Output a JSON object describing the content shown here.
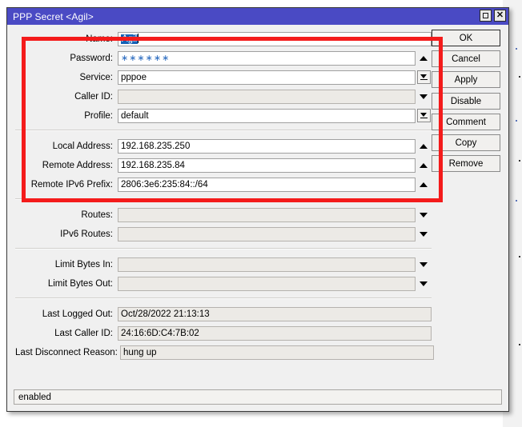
{
  "window": {
    "title": "PPP Secret <Agil>",
    "maximize_icon": "maximize-icon",
    "close_icon": "close-icon",
    "close_glyph": "✕"
  },
  "form": {
    "groups": [
      {
        "name": "credentials",
        "fields": [
          {
            "label": "Name:",
            "value": "Agil",
            "type": "text-selected",
            "adorn": "none",
            "state": "editable"
          },
          {
            "label": "Password:",
            "value": "",
            "type": "password",
            "adorn": "tri-up",
            "state": "editable",
            "masked": "∗∗∗∗∗∗"
          },
          {
            "label": "Service:",
            "value": "pppoe",
            "type": "text",
            "adorn": "dropdown",
            "state": "editable"
          },
          {
            "label": "Caller ID:",
            "value": "",
            "type": "text",
            "adorn": "tri-down",
            "state": "disabled"
          },
          {
            "label": "Profile:",
            "value": "default",
            "type": "text",
            "adorn": "dropdown",
            "state": "editable"
          }
        ]
      },
      {
        "name": "addresses",
        "fields": [
          {
            "label": "Local Address:",
            "value": "192.168.235.250",
            "type": "text",
            "adorn": "tri-up",
            "state": "editable"
          },
          {
            "label": "Remote Address:",
            "value": "192.168.235.84",
            "type": "text",
            "adorn": "tri-up",
            "state": "editable"
          },
          {
            "label": "Remote IPv6 Prefix:",
            "value": "2806:3e6:235:84::/64",
            "type": "text",
            "adorn": "tri-up",
            "state": "editable"
          }
        ]
      },
      {
        "name": "routes",
        "fields": [
          {
            "label": "Routes:",
            "value": "",
            "type": "text",
            "adorn": "tri-down",
            "state": "disabled"
          },
          {
            "label": "IPv6 Routes:",
            "value": "",
            "type": "text",
            "adorn": "tri-down",
            "state": "disabled"
          }
        ]
      },
      {
        "name": "limits",
        "fields": [
          {
            "label": "Limit Bytes In:",
            "value": "",
            "type": "text",
            "adorn": "tri-down",
            "state": "disabled"
          },
          {
            "label": "Limit Bytes Out:",
            "value": "",
            "type": "text",
            "adorn": "tri-down",
            "state": "disabled"
          }
        ]
      },
      {
        "name": "last-session",
        "fields": [
          {
            "label": "Last Logged Out:",
            "value": "Oct/28/2022 21:13:13",
            "type": "text",
            "adorn": "none",
            "state": "readonly"
          },
          {
            "label": "Last Caller ID:",
            "value": "24:16:6D:C4:7B:02",
            "type": "text",
            "adorn": "none",
            "state": "readonly"
          },
          {
            "label": "Last Disconnect Reason:",
            "value": "hung up",
            "type": "text",
            "adorn": "none",
            "state": "readonly"
          }
        ]
      }
    ]
  },
  "buttons": [
    {
      "label": "OK",
      "default": true,
      "gap": false
    },
    {
      "label": "Cancel",
      "default": false,
      "gap": false
    },
    {
      "label": "Apply",
      "default": false,
      "gap": false
    },
    {
      "label": "Disable",
      "default": false,
      "gap": true
    },
    {
      "label": "Comment",
      "default": false,
      "gap": false
    },
    {
      "label": "Copy",
      "default": false,
      "gap": false
    },
    {
      "label": "Remove",
      "default": false,
      "gap": false
    }
  ],
  "status": {
    "text": "enabled"
  },
  "annotation": {
    "type": "red-rectangle",
    "color": "#f41b1b"
  },
  "colors": {
    "titlebar": "#4a4ac4",
    "dialog_bg": "#f0f0f0",
    "field_bg": "#ffffff",
    "field_disabled_bg": "#eceae6",
    "selection": "#1562b6",
    "annotation_red": "#f41b1b"
  }
}
